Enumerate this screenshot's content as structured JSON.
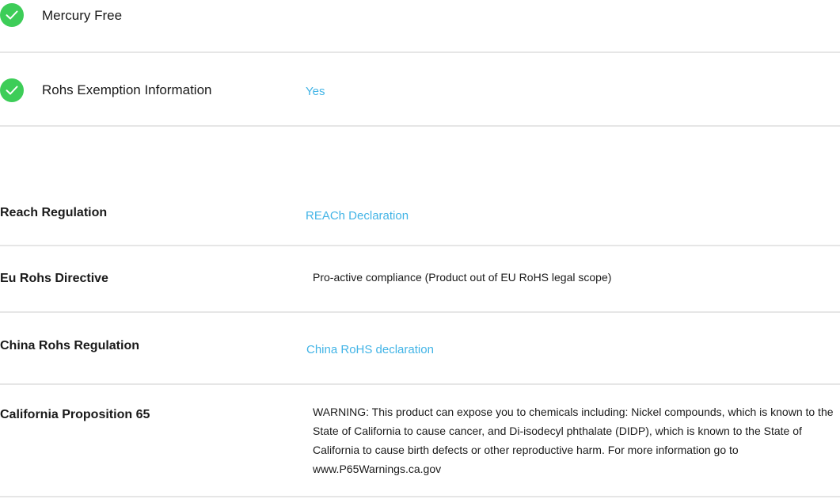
{
  "features": [
    {
      "label": "Mercury Free",
      "value": ""
    },
    {
      "label": "Rohs Exemption Information",
      "value": "Yes"
    }
  ],
  "regulations": [
    {
      "label": "Reach Regulation",
      "value": "REACh Declaration"
    },
    {
      "label": "Eu Rohs Directive",
      "value": "Pro-active compliance (Product out of EU RoHS legal scope)"
    },
    {
      "label": "China Rohs Regulation",
      "value": "China RoHS declaration"
    },
    {
      "label": "California Proposition 65",
      "value": "WARNING: This product can expose you to chemicals including: Nickel compounds, which is known to the State of California to cause cancer, and Di-isodecyl phthalate (DIDP), which is known to the State of California to cause birth defects or other reproductive harm. For more information go to www.P65Warnings.ca.gov"
    }
  ],
  "colors": {
    "check": "#3dcd58",
    "link": "#42b4e6",
    "divider": "#e6e6e6",
    "text": "#1a1a1a"
  },
  "icons": {
    "check": "check-circle-icon"
  }
}
